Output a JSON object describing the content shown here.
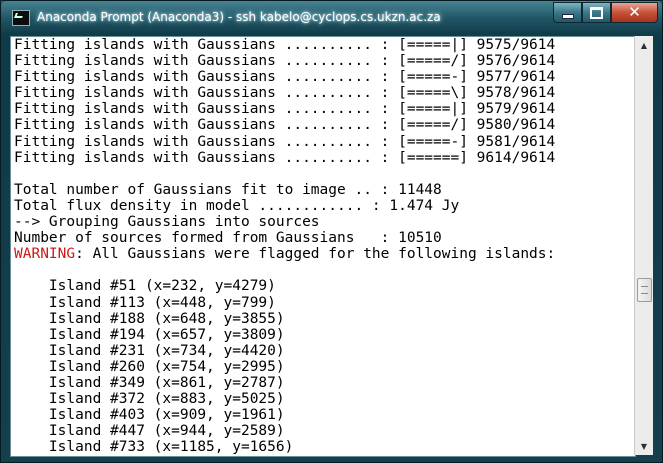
{
  "window": {
    "title": "Anaconda Prompt (Anaconda3) - ssh  kabelo@cyclops.cs.ukzn.ac.za",
    "controls": {
      "minimize_icon": "minimize-icon",
      "maximize_icon": "maximize-icon",
      "close_label": "✕"
    }
  },
  "console": {
    "fitting_lines": [
      "Fitting islands with Gaussians .......... : [=====|] 9575/9614",
      "Fitting islands with Gaussians .......... : [=====/] 9576/9614",
      "Fitting islands with Gaussians .......... : [=====-] 9577/9614",
      "Fitting islands with Gaussians .......... : [=====\\] 9578/9614",
      "Fitting islands with Gaussians .......... : [=====|] 9579/9614",
      "Fitting islands with Gaussians .......... : [=====/] 9580/9614",
      "Fitting islands with Gaussians .......... : [=====-] 9581/9614",
      "Fitting islands with Gaussians .......... : [======] 9614/9614"
    ],
    "blank1": "",
    "total_gaussians": "Total number of Gaussians fit to image .. : 11448",
    "total_flux": "Total flux density in model ............ : 1.474 Jy",
    "grouping": "--> Grouping Gaussians into sources",
    "num_sources": "Number of sources formed from Gaussians   : 10510",
    "warning_label": "WARNING",
    "warning_text": ": All Gaussians were flagged for the following islands:",
    "blank2": "",
    "islands": [
      "    Island #51 (x=232, y=4279)",
      "    Island #113 (x=448, y=799)",
      "    Island #188 (x=648, y=3855)",
      "    Island #194 (x=657, y=3809)",
      "    Island #231 (x=734, y=4420)",
      "    Island #260 (x=754, y=2995)",
      "    Island #349 (x=861, y=2787)",
      "    Island #372 (x=883, y=5025)",
      "    Island #403 (x=909, y=1961)",
      "    Island #447 (x=944, y=2589)",
      "    Island #733 (x=1185, y=1656)"
    ]
  },
  "scrollbar": {
    "up_arrow": "▲",
    "down_arrow": "▼"
  }
}
